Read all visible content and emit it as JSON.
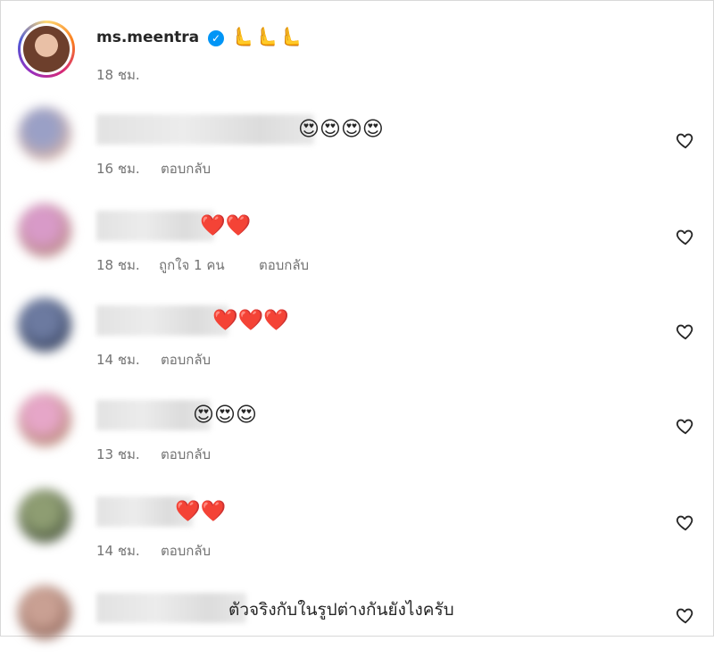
{
  "post": {
    "username": "ms.meentra",
    "verified_icon": "verified-check-icon",
    "emoji": "🫷🫷🫷",
    "time": "18 ชม."
  },
  "comments": [
    {
      "text": "😍😍😍😍",
      "time": "16 ชม.",
      "likes": "",
      "reply": "ตอบกลับ",
      "avatar_colors": [
        "#9aa0c6",
        "#e0b7a4"
      ]
    },
    {
      "text": "❤️❤️",
      "time": "18 ชม.",
      "likes": "ถูกใจ 1 คน",
      "reply": "ตอบกลับ",
      "avatar_colors": [
        "#d89ac8",
        "#b5877a"
      ]
    },
    {
      "text": "❤️❤️❤️",
      "time": "14 ชม.",
      "likes": "",
      "reply": "ตอบกลับ",
      "avatar_colors": [
        "#6c7aa0",
        "#2f3a55"
      ]
    },
    {
      "text": "😍😍😍",
      "time": "13 ชม.",
      "likes": "",
      "reply": "ตอบกลับ",
      "avatar_colors": [
        "#e6a6c8",
        "#b18468"
      ]
    },
    {
      "text": "❤️❤️",
      "time": "14 ชม.",
      "likes": "",
      "reply": "ตอบกลับ",
      "avatar_colors": [
        "#8e9d72",
        "#3e4a35"
      ]
    },
    {
      "text": "ตัวจริงกับในรูปต่างกันยังไงครับ",
      "time": "",
      "likes": "",
      "reply": "",
      "avatar_colors": [
        "#c9a093",
        "#8a6054"
      ]
    }
  ],
  "icons": {
    "like": "heart-outline-icon"
  },
  "colors": {
    "meta_text": "#737373",
    "verified": "#0095f6",
    "primary_text": "#262626"
  }
}
